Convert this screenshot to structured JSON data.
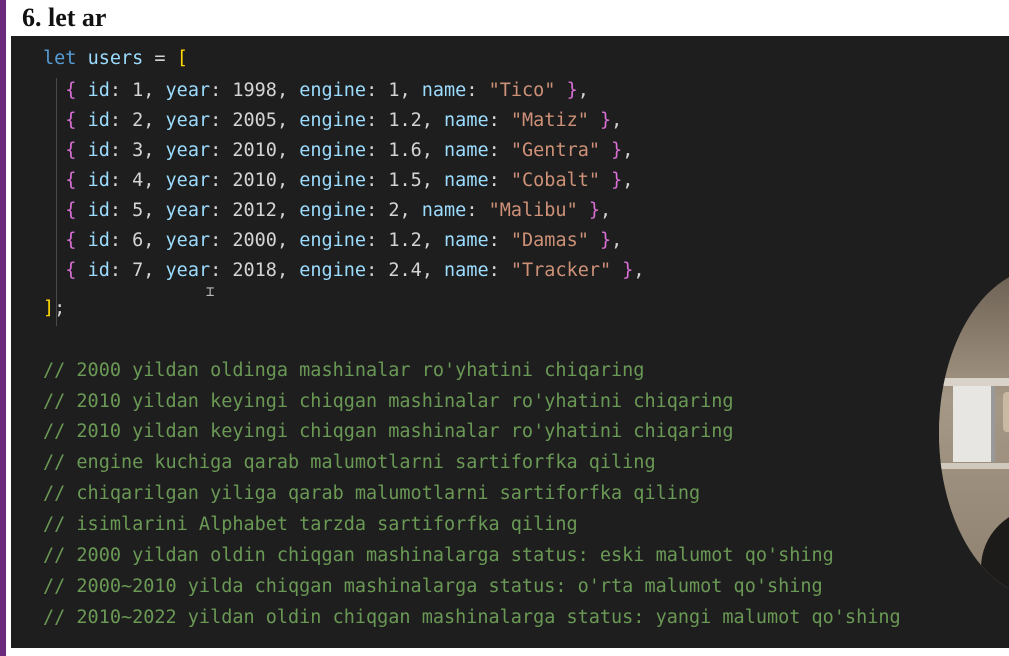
{
  "slide": {
    "title": "6. let ar"
  },
  "code": {
    "declaration": {
      "keyword": "let",
      "variable": "users",
      "equals": "=",
      "open_bracket": "["
    },
    "users": [
      {
        "id": "1",
        "year": "1998",
        "engine": "1",
        "name": "\"Tico\""
      },
      {
        "id": "2",
        "year": "2005",
        "engine": "1.2",
        "name": "\"Matiz\""
      },
      {
        "id": "3",
        "year": "2010",
        "engine": "1.6",
        "name": "\"Gentra\""
      },
      {
        "id": "4",
        "year": "2010",
        "engine": "1.5",
        "name": "\"Cobalt\""
      },
      {
        "id": "5",
        "year": "2012",
        "engine": "2",
        "name": "\"Malibu\""
      },
      {
        "id": "6",
        "year": "2000",
        "engine": "1.2",
        "name": "\"Damas\""
      },
      {
        "id": "7",
        "year": "2018",
        "engine": "2.4",
        "name": "\"Tracker\""
      }
    ],
    "closing": {
      "bracket": "]",
      "semicolon": ";"
    },
    "comments": [
      "// 2000 yildan oldinga mashinalar ro'yhatini chiqaring",
      "// 2010 yildan keyingi chiqgan mashinalar ro'yhatini chiqaring",
      "// 2010 yildan keyingi chiqgan mashinalar ro'yhatini chiqaring",
      "// engine kuchiga qarab malumotlarni sartiforfka qiling",
      "// chiqarilgan yiliga qarab malumotlarni sartiforfka qiling",
      "// isimlarini Alphabet tarzda sartiforfka qiling",
      "// 2000 yildan oldin chiqgan mashinalarga status: eski malumot qo'shing",
      "// 2000~2010 yilda chiqgan mashinalarga status: o'rta malumot qo'shing",
      "// 2010~2022 yildan oldin chiqgan mashinalarga status: yangi malumot qo'shing"
    ]
  },
  "colors": {
    "editor_bg": "#1e1e1e",
    "keyword": "#569cd6",
    "property": "#9cdcfe",
    "string": "#ce9178",
    "comment": "#6a9955",
    "bracket": "#ffd700",
    "brace": "#da70d6"
  }
}
